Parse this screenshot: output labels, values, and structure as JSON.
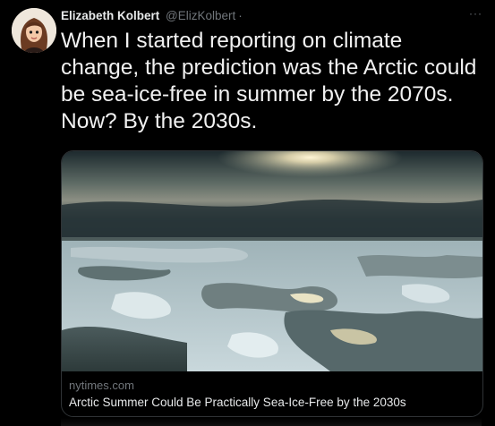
{
  "tweet": {
    "author_name": "Elizabeth Kolbert",
    "author_handle": "@ElizKolbert",
    "separator": "·",
    "more_label": "···",
    "text": "When I started reporting on climate change, the prediction was the Arctic could be sea-ice-free in summer by the 2070s. Now? By the 2030s."
  },
  "card": {
    "domain": "nytimes.com",
    "title": "Arctic Summer Could Be Practically Sea-Ice-Free by the 2030s"
  },
  "colors": {
    "background": "#000000",
    "text_primary": "#e7e9ea",
    "text_secondary": "#71767b",
    "border": "#2f3336"
  }
}
